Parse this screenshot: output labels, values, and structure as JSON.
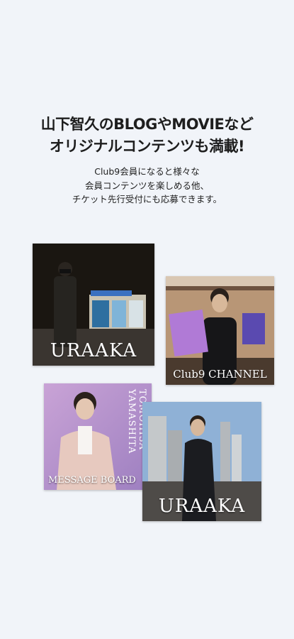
{
  "promo": {
    "headline_line1": "山下智久のBLOGやMOVIEなど",
    "headline_line2": "オリジナルコンテンツも満載!",
    "sub_line1": "Club9会員になると様々な",
    "sub_line2": "会員コンテンツを楽しめる他、",
    "sub_line3": "チケット先行受付にも応募できます。"
  },
  "cards": {
    "uraaka_night": {
      "caption": "URAAKA"
    },
    "channel": {
      "caption": "Club9 CHANNEL"
    },
    "message": {
      "caption": "MESSAGE BOARD",
      "vertical_text": "TOMOHISA YAMASHITA"
    },
    "uraaka_rooftop": {
      "caption": "URAAKA"
    }
  },
  "colors": {
    "background": "#f1f4f9",
    "message_card": "#b48cc4"
  }
}
